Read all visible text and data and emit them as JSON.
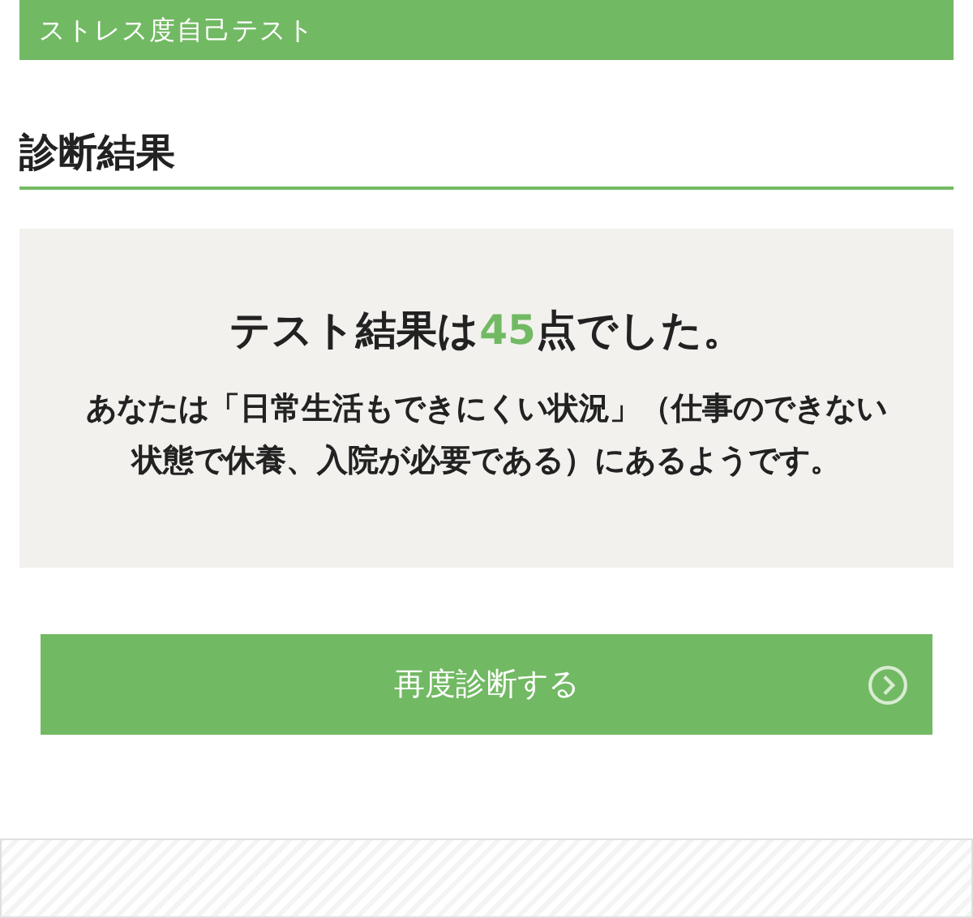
{
  "header": {
    "title": "ストレス度自己テスト"
  },
  "section": {
    "heading": "診断結果"
  },
  "result": {
    "prefix": "テスト結果は",
    "score": "45",
    "suffix": "点でした。",
    "description": "あなたは「日常生活もできにくい状況」（仕事のできない状態で休養、入院が必要である）にあるようです。"
  },
  "retry_button": {
    "label": "再度診断する"
  }
}
